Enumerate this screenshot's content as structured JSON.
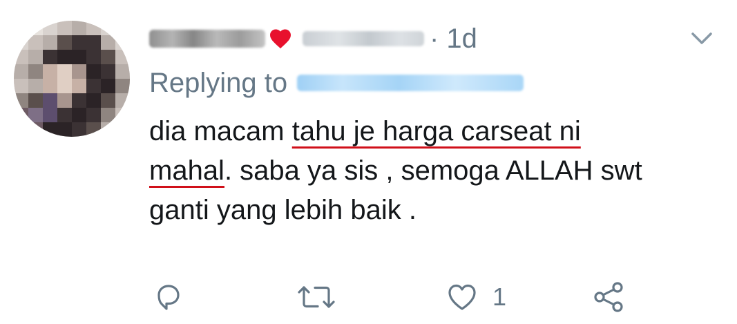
{
  "tweet": {
    "time": "· 1d",
    "reply_prefix": "Replying to",
    "body_lines": [
      [
        "dia macam ",
        "tahu je harga carseat ni"
      ],
      [
        "mahal",
        ". saba ya sis , semoga ALLAH swt"
      ],
      [
        "ganti yang lebih baik ."
      ]
    ],
    "underline_color": "#d0101a"
  },
  "actions": {
    "like_count": "1"
  },
  "colors": {
    "secondary_text": "#657786",
    "primary_text": "#14171a",
    "heart": "#e0245e"
  },
  "icons": [
    "reply-icon",
    "retweet-icon",
    "like-icon",
    "share-icon",
    "chevron-down-icon",
    "heart-emoji-icon"
  ]
}
